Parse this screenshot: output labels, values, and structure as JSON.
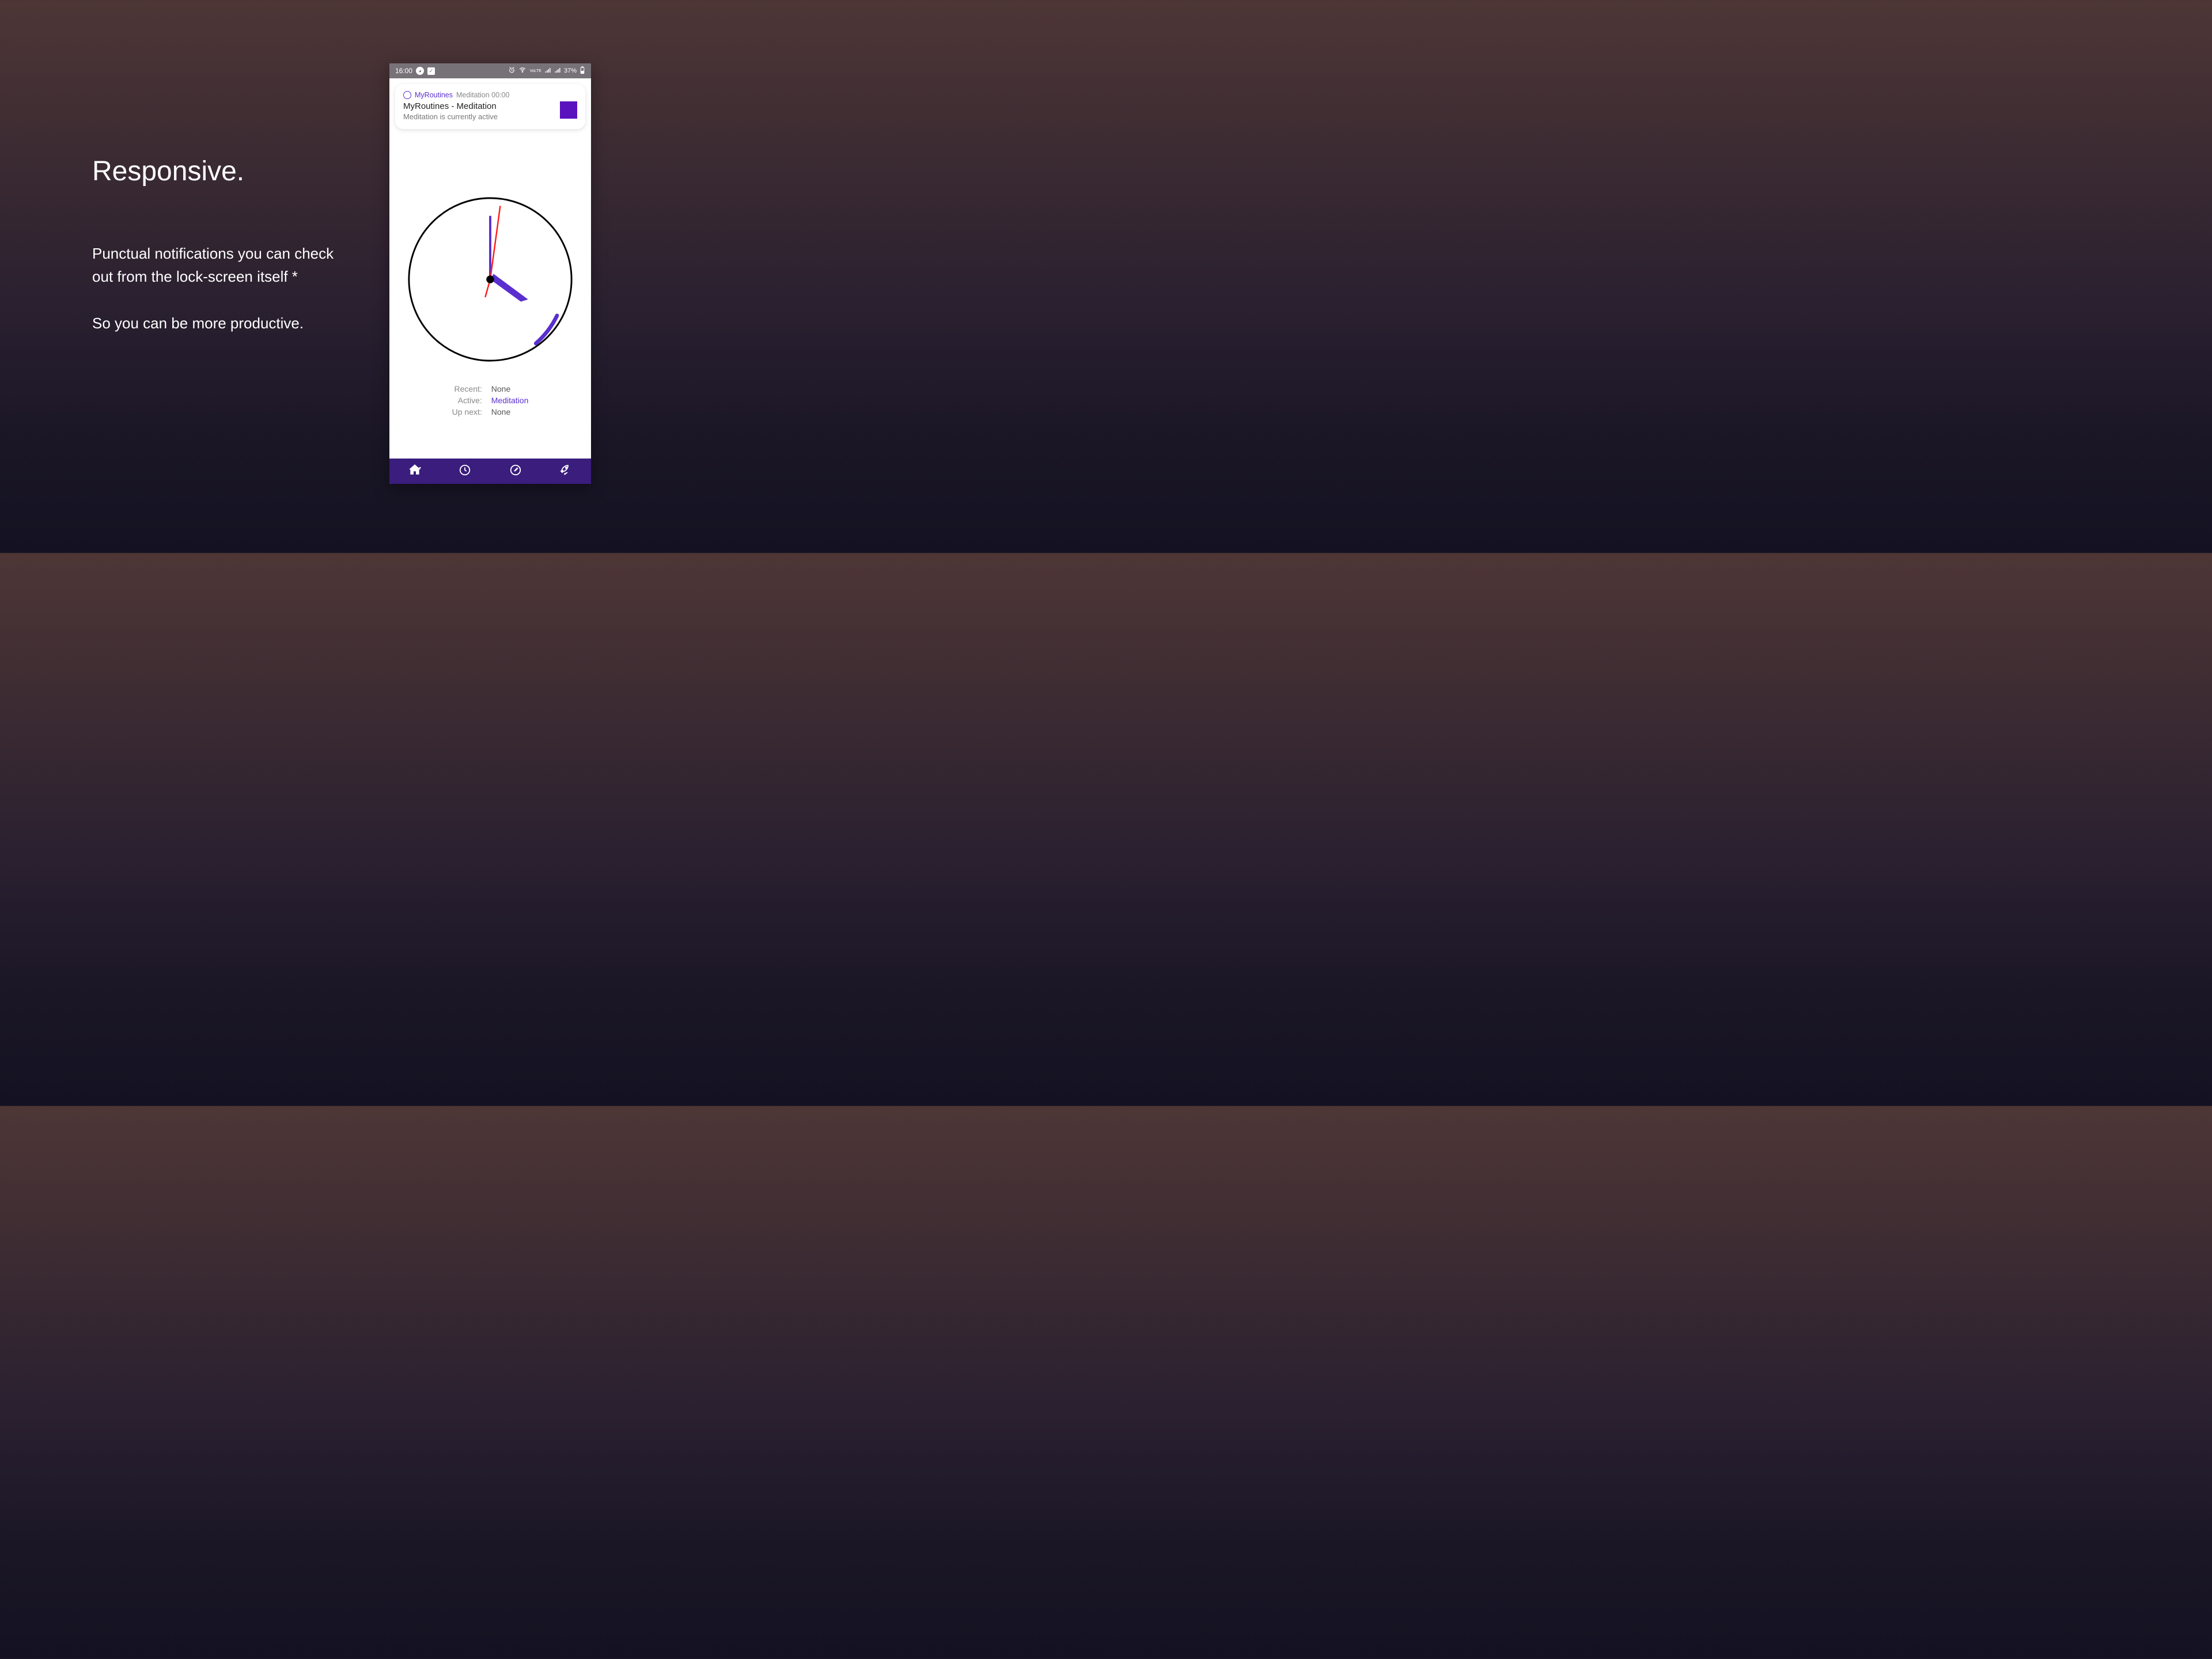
{
  "promo": {
    "title": "Responsive.",
    "p1": "Punctual notifications you can check out from the lock-screen itself *",
    "p2": "So you can be more productive."
  },
  "statusbar": {
    "time": "16:00",
    "battery": "37%",
    "net_label": "VoLTE"
  },
  "notification": {
    "app_name": "MyRoutines",
    "meta": "Meditation 00:00",
    "title": "MyRoutines - Meditation",
    "body": "Meditation is currently active"
  },
  "status": {
    "recent_label": "Recent:",
    "recent_value": "None",
    "active_label": "Active:",
    "active_value": "Meditation",
    "upnext_label": "Up next:",
    "upnext_value": "None"
  },
  "colors": {
    "accent": "#5a2fcf",
    "nav_bg": "#3a1d7d"
  }
}
